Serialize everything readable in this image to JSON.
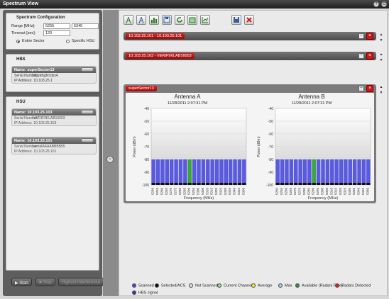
{
  "window": {
    "title": "Spectrum View"
  },
  "config": {
    "heading": "Spectrum Configuration",
    "range_label": "Range [MHz]:",
    "range_from": "5255",
    "range_to": "5345",
    "timeout_label": "Timeout [sec]:",
    "timeout_value": "120",
    "radio_entire": "Entire Sector",
    "radio_specific": "Specific HSU",
    "selected": "Entire Sector"
  },
  "hbs": {
    "heading": "HBS",
    "name_label": "Name:",
    "name": "superSector13",
    "serial_label": "Serial Number:",
    "serial": "thjuikbgfvcdsx4",
    "ip_label": "IP Address:",
    "ip": "10.103.25.1"
  },
  "hsu": {
    "heading": "HSU",
    "cards": [
      {
        "name_label": "Name:",
        "name": "10.103.25.103",
        "serial_label": "Serial Number:",
        "serial": "VERIF9KLAB16003",
        "ip_label": "IP Address:",
        "ip": "10.103.25.103"
      },
      {
        "name_label": "Name:",
        "name": "10.103.25.101",
        "serial_label": "Serial Number:",
        "serial": "serialAAAABBBB55",
        "ip_label": "IP Address:",
        "ip": "10.103.25.101"
      }
    ]
  },
  "actions": {
    "start": "Start",
    "stop": "Stop",
    "interference": "Highest Interference"
  },
  "strips": [
    {
      "label": "10.103.25.101 - 10.103.25.101"
    },
    {
      "label": "10.103.25.103 - VERIF9KLAB16003"
    },
    {
      "label": "superSector13"
    }
  ],
  "toolbar": {
    "icons": [
      "antenna-icon",
      "antenna-alt-icon",
      "chart-icon",
      "save-icon",
      "refresh-icon",
      "export-icon",
      "grid-icon",
      "disk-icon",
      "close-red-icon"
    ]
  },
  "legend": [
    {
      "label": "Scanned",
      "color": "#4b4bd8"
    },
    {
      "label": "Selected/ACS",
      "color": "#111111"
    },
    {
      "label": "Not Scanned",
      "color": "#dddddd"
    },
    {
      "label": "Current Channel",
      "color": "#8fdc8f"
    },
    {
      "label": "Average",
      "color": "#f4f41c"
    },
    {
      "label": "Max",
      "color": "#8fd8e6"
    },
    {
      "label": "Available (Radars Free)",
      "color": "#2a9a2a"
    },
    {
      "label": "Radars Detected",
      "color": "#e02020"
    },
    {
      "label": "HBS signal",
      "color": "#3a3a9a"
    }
  ],
  "chart_data": [
    {
      "type": "bar",
      "title": "Antenna A",
      "subtitle": "11/28/2011 2:07:31 PM",
      "xlabel": "Frequency (MHz)",
      "ylabel": "Power (dBm)",
      "ylim": [
        -100,
        -40
      ],
      "yticks": [
        -40,
        -50,
        -60,
        -70,
        -80,
        -90,
        -100
      ],
      "categories": [
        "5250",
        "5255",
        "5260",
        "5265",
        "5270",
        "5275",
        "5280",
        "5285",
        "5290",
        "5295",
        "5300",
        "5305",
        "5310",
        "5315",
        "5320",
        "5325",
        "5330",
        "5335",
        "5340",
        "5345",
        "5350"
      ],
      "values": [
        -80,
        -80,
        -80,
        -80,
        -80,
        -80,
        -80,
        -80,
        -80,
        -80,
        -80,
        -80,
        -80,
        -80,
        -80,
        -80,
        -80,
        -80,
        -80,
        -80,
        -80
      ],
      "highlight_index": 8,
      "bar_color": "#5a5ae0",
      "highlight_color": "#3aa53a"
    },
    {
      "type": "bar",
      "title": "Antenna B",
      "subtitle": "11/28/2011 2:07:31 PM",
      "xlabel": "Frequency (MHz)",
      "ylabel": "Power (dBm)",
      "ylim": [
        -100,
        -40
      ],
      "yticks": [
        -40,
        -50,
        -60,
        -70,
        -80,
        -90,
        -100
      ],
      "categories": [
        "5250",
        "5255",
        "5260",
        "5265",
        "5270",
        "5275",
        "5280",
        "5285",
        "5290",
        "5295",
        "5300",
        "5305",
        "5310",
        "5315",
        "5320",
        "5325",
        "5330",
        "5335",
        "5340",
        "5345",
        "5350"
      ],
      "values": [
        -80,
        -80,
        -80,
        -80,
        -80,
        -80,
        -80,
        -80,
        -80,
        -80,
        -80,
        -80,
        -80,
        -80,
        -80,
        -80,
        -80,
        -80,
        -80,
        -80,
        -80
      ],
      "highlight_index": 8,
      "bar_color": "#5a5ae0",
      "highlight_color": "#3aa53a"
    }
  ]
}
